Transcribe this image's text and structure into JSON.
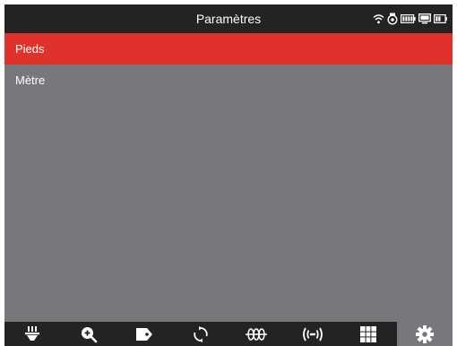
{
  "header": {
    "title": "Paramètres",
    "status_icons": [
      "wifi-icon",
      "camera-icon",
      "battery-full-icon",
      "monitor-icon",
      "battery-half-icon"
    ]
  },
  "options": [
    {
      "label": "Pieds",
      "selected": true
    },
    {
      "label": "Mètre",
      "selected": false
    }
  ],
  "toolbar": {
    "items": [
      {
        "icon": "probe-light-icon",
        "active": false
      },
      {
        "icon": "zoom-in-icon",
        "active": false
      },
      {
        "icon": "tag-icon",
        "active": false
      },
      {
        "icon": "rotate-icon",
        "active": false
      },
      {
        "icon": "coil-icon",
        "active": false
      },
      {
        "icon": "signal-icon",
        "active": false
      },
      {
        "icon": "grid-icon",
        "active": false
      },
      {
        "icon": "settings-gear-icon",
        "active": true
      }
    ]
  },
  "colors": {
    "titlebar": "#232323",
    "background": "#77787c",
    "selected": "#e0322c",
    "text": "#ffffff"
  }
}
